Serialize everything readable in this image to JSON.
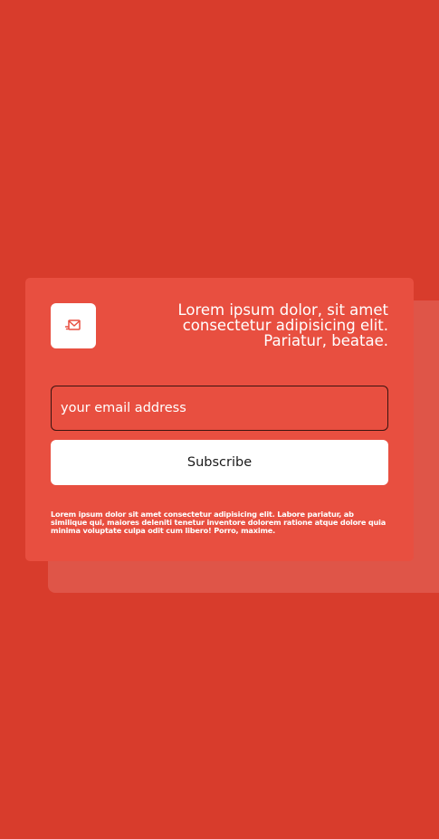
{
  "colors": {
    "background": "#d83c2c",
    "card": "#e84f40",
    "shadow_card": "#df5548",
    "icon_accent": "#e84f40",
    "button_bg": "#ffffff"
  },
  "card": {
    "icon": "mail-send-icon",
    "headline": "Lorem ipsum dolor, sit amet consectetur adipisicing elit. Pariatur, beatae.",
    "email_input": {
      "placeholder": "your email address",
      "value": ""
    },
    "subscribe_label": "Subscribe",
    "fine_print": "Lorem ipsum dolor sit amet consectetur adipisicing elit. Labore pariatur, ab similique qui, maiores deleniti tenetur inventore dolorem ratione atque dolore quia minima voluptate culpa odit cum libero! Porro, maxime."
  }
}
